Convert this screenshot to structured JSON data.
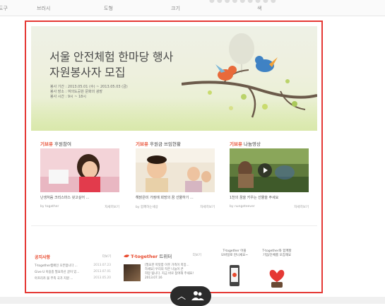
{
  "toolbar": {
    "items": [
      "도구",
      "브러시",
      "도형",
      "크기",
      "색"
    ]
  },
  "banner": {
    "title_line1": "서울 안전체험 한마당 행사",
    "title_line2": "자원봉사자 모집",
    "info": [
      "봉사 기간 : 2013.05.01 (수) ~ 2013.05.03 (금)",
      "봉사 장소 : 여의도공원 문화의 광장",
      "봉사 시간 : 9시 ~ 18시"
    ]
  },
  "cards": [
    {
      "category": "기브유",
      "title": "후원참여",
      "caption": "난생처음 크리스마스 갖고싶어 ...",
      "by": "by togather",
      "more": "자세히보기"
    },
    {
      "category": "기브유",
      "title": "후원금 쓰임현황",
      "caption": "해맑은미 가정에 희망의 꿈 선물하기 ...",
      "by": "by 함께하는세상",
      "more": "자세히보기"
    },
    {
      "category": "기브유",
      "title": "나눔영상",
      "caption": "1천의 꿈을 키우는 선물을 주세요",
      "by": "by nungeteever",
      "more": "자세히보기"
    }
  ],
  "notice": {
    "title": "공지사항",
    "more": "더보기",
    "rows": [
      {
        "text": "T-together캠페인 오픈합니다 ...",
        "date": "2013.07.23"
      },
      {
        "text": "Give U 이용중 필요하신 글이 있...",
        "date": "2013.07.01"
      },
      {
        "text": "아프리카 물 부족 국가 지원 ...",
        "date": "2013.05.20"
      }
    ]
  },
  "twitter": {
    "brand": "T-together",
    "title_suffix": " 트위터",
    "more": "더보기",
    "text_lines": [
      "[필요한 따뜻함 이웃 가족이 희망...",
      "하세요] 우리의 작은 나눔이 큰",
      "희망 됩니다. 지금 바로 참여해 주세요!",
      "2013.07.16"
    ]
  },
  "apps": [
    {
      "line1": "T-together 어플",
      "line2": "모바일로 만나세요~"
    },
    {
      "line1": "T-together와 함께할",
      "line2": "기업/단체를 모집해요"
    }
  ],
  "colors": {
    "frame": "#e53935",
    "accent": "#e84a2e"
  }
}
